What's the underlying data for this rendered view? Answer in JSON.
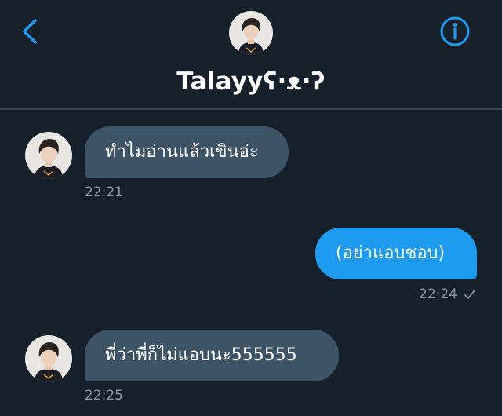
{
  "conversation": {
    "title": "Talayyʕ·ᴥ·ʔ"
  },
  "colors": {
    "background": "#15202b",
    "accent": "#1d9bf0",
    "incoming_bubble": "#3d5466",
    "timestamp": "#8899a6",
    "divider": "#38444d"
  },
  "icons": {
    "back": "chevron-left-icon",
    "info": "info-circle-icon",
    "read_status": "checkmark-icon"
  },
  "messages": [
    {
      "direction": "incoming",
      "text": "ทำไมอ่านแล้วเขินอ่ะ",
      "time": "22:21"
    },
    {
      "direction": "outgoing",
      "text": "(อย่าแอบชอบ)",
      "time": "22:24"
    },
    {
      "direction": "incoming",
      "text": "พี่ว่าพี่ก็ไม่แอบนะ555555",
      "time": "22:25"
    }
  ]
}
